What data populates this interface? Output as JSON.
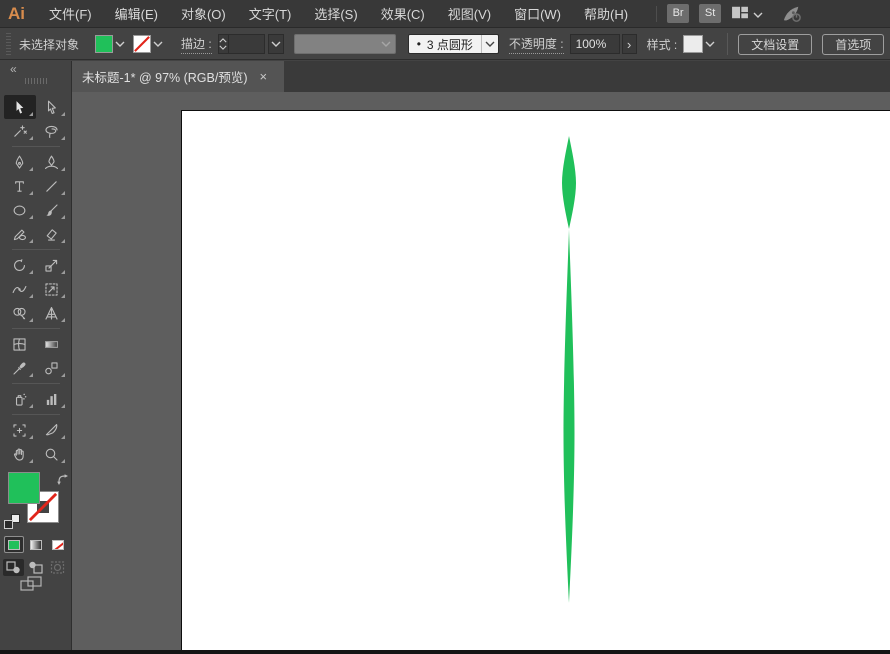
{
  "app": {
    "logo_text": "Ai"
  },
  "menubar": {
    "items": [
      "文件(F)",
      "编辑(E)",
      "对象(O)",
      "文字(T)",
      "选择(S)",
      "效果(C)",
      "视图(V)",
      "窗口(W)",
      "帮助(H)"
    ],
    "bridge_button": "Br",
    "stock_button": "St"
  },
  "options_bar": {
    "status_text": "未选择对象",
    "fill_color": "#20C05A",
    "stroke_has_color": false,
    "stroke_label": "描边 :",
    "stroke_weight_value": "",
    "brush_bullet": "•",
    "brush_value": "3 点圆形",
    "opacity_label": "不透明度 :",
    "opacity_value": "100%",
    "opacity_more_glyph": "›",
    "style_label": "样式 :",
    "document_setup_button": "文档设置",
    "preferences_button": "首选项"
  },
  "tab_bar": {
    "active_tab_title": "未标题-1* @ 97% (RGB/预览)",
    "close_glyph": "×"
  },
  "toolbar": {
    "collapse_glyph": "«",
    "selected_tool": "selection",
    "fill_color": "#20C05A",
    "stroke_color": "none",
    "tools": [
      "selection",
      "direct-selection",
      "magic-wand",
      "lasso",
      "pen",
      "curvature",
      "type",
      "line-segment",
      "ellipse",
      "paintbrush",
      "shaper",
      "eraser",
      "rotate",
      "scale",
      "width",
      "free-transform",
      "shape-builder",
      "perspective-grid",
      "mesh",
      "gradient",
      "eyedropper",
      "blend",
      "symbol-sprayer",
      "column-graph",
      "artboard",
      "slice",
      "hand",
      "zoom"
    ]
  },
  "canvas": {
    "pasteboard_color": "#5e5e5e",
    "artboard_color": "#ffffff",
    "shape": {
      "name": "green-leaf-brush-stroke",
      "color": "#20C05A"
    }
  }
}
